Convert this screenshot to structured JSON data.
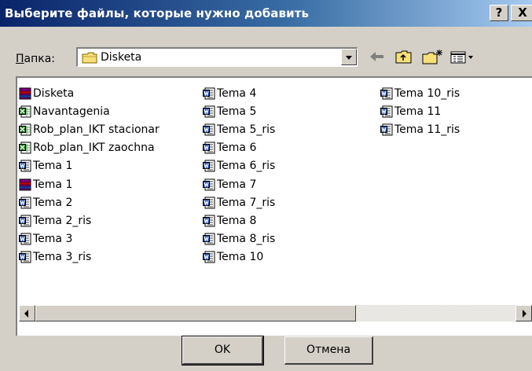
{
  "window": {
    "title": "Выберите файлы, которые нужно добавить",
    "help_label": "?",
    "close_label": "X"
  },
  "folder": {
    "label_accel": "П",
    "label_rest": "апка:",
    "current": "Disketa"
  },
  "toolbar": {
    "icons": [
      "back-arrow-icon",
      "up-folder-icon",
      "new-folder-icon",
      "view-menu-icon"
    ]
  },
  "files": [
    {
      "name": "Disketa",
      "icon": "database-icon"
    },
    {
      "name": "Navantagenia",
      "icon": "excel-icon"
    },
    {
      "name": "Rob_plan_IKT stacionar",
      "icon": "excel-icon"
    },
    {
      "name": "Rob_plan_IKT zaochna",
      "icon": "excel-icon"
    },
    {
      "name": "Tema 1",
      "icon": "word-icon"
    },
    {
      "name": "Tema 1",
      "icon": "database-icon"
    },
    {
      "name": "Tema 2",
      "icon": "word-icon"
    },
    {
      "name": "Tema 2_ris",
      "icon": "word-icon"
    },
    {
      "name": "Tema 3",
      "icon": "word-icon"
    },
    {
      "name": "Tema 3_ris",
      "icon": "word-icon"
    },
    {
      "name": "Tema 4",
      "icon": "word-icon"
    },
    {
      "name": "Tema 5",
      "icon": "word-icon"
    },
    {
      "name": "Tema 5_ris",
      "icon": "word-icon"
    },
    {
      "name": "Tema 6",
      "icon": "word-icon"
    },
    {
      "name": "Tema 6_ris",
      "icon": "word-icon"
    },
    {
      "name": "Tema 7",
      "icon": "word-icon"
    },
    {
      "name": "Tema 7_ris",
      "icon": "word-icon"
    },
    {
      "name": "Tema 8",
      "icon": "word-icon"
    },
    {
      "name": "Tema 8_ris",
      "icon": "word-icon"
    },
    {
      "name": "Tema 10",
      "icon": "word-icon"
    },
    {
      "name": "Tema 10_ris",
      "icon": "word-icon"
    },
    {
      "name": "Tema 11",
      "icon": "word-icon"
    },
    {
      "name": "Tema 11_ris",
      "icon": "word-icon"
    }
  ],
  "buttons": {
    "ok_label": "OK",
    "cancel_label": "Отмена"
  }
}
